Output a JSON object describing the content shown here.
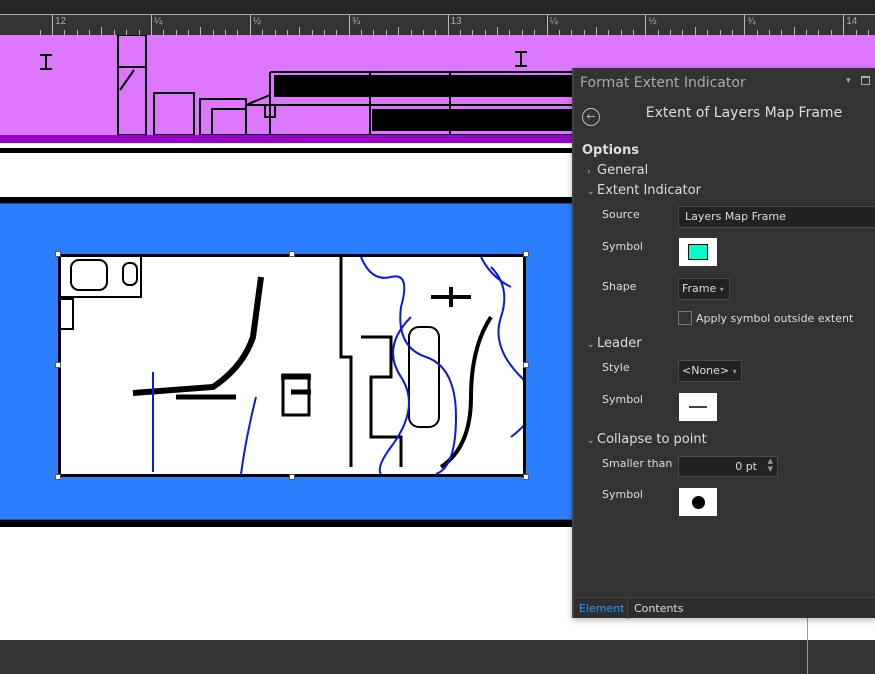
{
  "ruler": {
    "labels": [
      "12",
      "¼",
      "½",
      "¾",
      "13",
      "¼",
      "½",
      "¾",
      "14"
    ]
  },
  "colors": {
    "band_magenta": "#dd77ff",
    "band_blue": "#2b7fff",
    "accent": "#1e9bff",
    "fill_symbol": "#00ffc8"
  },
  "panel": {
    "title": "Format Extent Indicator",
    "subtitle": "Extent of Layers Map Frame",
    "options_heading": "Options",
    "sections": {
      "general": "General",
      "extent_indicator": "Extent Indicator",
      "leader": "Leader",
      "collapse": "Collapse to point"
    },
    "extent": {
      "source_label": "Source",
      "source_value": "Layers Map Frame",
      "symbol_label": "Symbol",
      "shape_label": "Shape",
      "shape_value": "Frame",
      "apply_outside_label": "Apply symbol outside extent",
      "apply_outside_checked": false
    },
    "leader": {
      "style_label": "Style",
      "style_value": "<None>",
      "symbol_label": "Symbol"
    },
    "collapse": {
      "smaller_label": "Smaller than",
      "smaller_value": "0 pt",
      "symbol_label": "Symbol"
    },
    "tabs": {
      "element": "Element",
      "contents": "Contents",
      "active": "Element"
    }
  }
}
